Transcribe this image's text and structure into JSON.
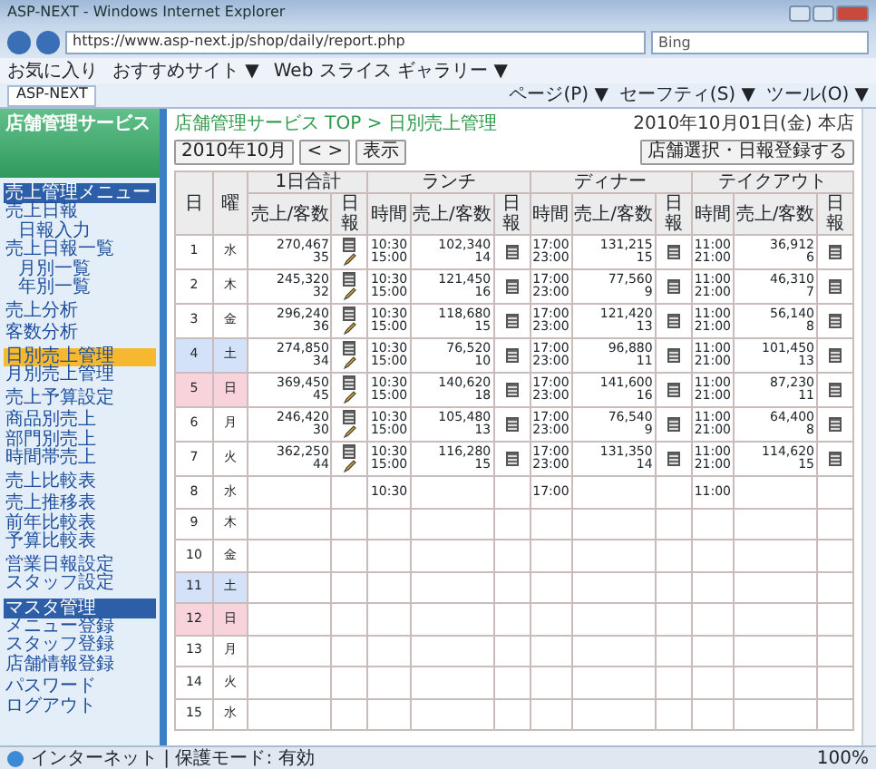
{
  "window": {
    "title": "ASP-NEXT - Windows Internet Explorer"
  },
  "browser": {
    "address": "https://www.asp-next.jp/shop/daily/report.php",
    "search_placeholder": "Bing",
    "favorites": [
      "お気に入り",
      "おすすめサイト ▼",
      "Web スライス ギャラリー ▼"
    ],
    "tab": "ASP-NEXT",
    "commands": [
      "ページ(P) ▼",
      "セーフティ(S) ▼",
      "ツール(O) ▼"
    ]
  },
  "sidebar": {
    "title": "店舗管理サービス",
    "sections": [
      {
        "title": "売上管理メニュー",
        "items": [
          {
            "label": "売上日報",
            "selected": false,
            "children": [
              {
                "label": "日報入力",
                "selected": false
              }
            ]
          },
          {
            "label": "売上日報一覧",
            "selected": false,
            "children": [
              {
                "label": "月別一覧",
                "selected": false
              },
              {
                "label": "年別一覧",
                "selected": false
              }
            ]
          }
        ]
      },
      {
        "items": [
          {
            "label": "売上分析",
            "selected": false
          }
        ]
      },
      {
        "items": [
          {
            "label": "客数分析",
            "selected": false
          }
        ]
      },
      {
        "items": [
          {
            "label": "日別売上管理",
            "selected": true
          },
          {
            "label": "月別売上管理",
            "selected": false
          }
        ]
      },
      {
        "items": [
          {
            "label": "売上予算設定",
            "selected": false
          }
        ]
      },
      {
        "items": [
          {
            "label": "商品別売上",
            "selected": false
          },
          {
            "label": "部門別売上",
            "selected": false
          },
          {
            "label": "時間帯売上",
            "selected": false
          }
        ]
      },
      {
        "items": [
          {
            "label": "売上比較表",
            "selected": false
          }
        ]
      },
      {
        "items": [
          {
            "label": "売上推移表",
            "selected": false
          },
          {
            "label": "前年比較表",
            "selected": false
          },
          {
            "label": "予算比較表",
            "selected": false
          }
        ]
      },
      {
        "items": [
          {
            "label": "営業日報設定",
            "selected": false
          },
          {
            "label": "スタッフ設定",
            "selected": false
          }
        ]
      },
      {
        "title": "マスタ管理",
        "items": [
          {
            "label": "メニュー登録",
            "selected": false
          },
          {
            "label": "スタッフ登録",
            "selected": false
          },
          {
            "label": "店舗情報登録",
            "selected": false
          }
        ]
      },
      {
        "items": [
          {
            "label": "パスワード",
            "selected": false
          },
          {
            "label": "ログアウト",
            "selected": false
          }
        ]
      }
    ]
  },
  "main": {
    "breadcrumb": "店舗管理サービス TOP > 日別売上管理",
    "date_info": "2010年10月01日(金) 本店",
    "month_select": "2010年10月",
    "nav_button": "< >",
    "show_button": "表示",
    "register_button": "店舗選択・日報登録する"
  },
  "table": {
    "day_header": "日",
    "weekday_header": "曜",
    "groups": [
      {
        "label": "1日合計",
        "columns": [
          "売上/客数",
          "日報"
        ]
      },
      {
        "label": "ランチ",
        "columns": [
          "時間",
          "売上/客数",
          "日報"
        ]
      },
      {
        "label": "ディナー",
        "columns": [
          "時間",
          "売上/客数",
          "日報"
        ]
      },
      {
        "label": "テイクアウト",
        "columns": [
          "時間",
          "売上/客数",
          "日報"
        ]
      }
    ],
    "rows": [
      {
        "day": "1",
        "weekday": "水",
        "cells": [
          {
            "sales": "270,467",
            "customers": "35",
            "report": true,
            "editable": true
          },
          {
            "times": [
              "10:30",
              "15:00"
            ],
            "sales": "102,340",
            "customers": "14",
            "report": true
          },
          {
            "times": [
              "17:00",
              "23:00"
            ],
            "sales": "131,215",
            "customers": "15",
            "report": true
          },
          {
            "times": [
              "11:00",
              "21:00"
            ],
            "sales": "36,912",
            "customers": "6",
            "report": true
          }
        ]
      },
      {
        "day": "2",
        "weekday": "木",
        "cells": [
          {
            "sales": "245,320",
            "customers": "32",
            "report": true,
            "editable": true
          },
          {
            "times": [
              "10:30",
              "15:00"
            ],
            "sales": "121,450",
            "customers": "16",
            "report": true
          },
          {
            "times": [
              "17:00",
              "23:00"
            ],
            "sales": "77,560",
            "customers": "9",
            "report": true
          },
          {
            "times": [
              "11:00",
              "21:00"
            ],
            "sales": "46,310",
            "customers": "7",
            "report": true
          }
        ]
      },
      {
        "day": "3",
        "weekday": "金",
        "cells": [
          {
            "sales": "296,240",
            "customers": "36",
            "report": true,
            "editable": true
          },
          {
            "times": [
              "10:30",
              "15:00"
            ],
            "sales": "118,680",
            "customers": "15",
            "report": true
          },
          {
            "times": [
              "17:00",
              "23:00"
            ],
            "sales": "121,420",
            "customers": "13",
            "report": true
          },
          {
            "times": [
              "11:00",
              "21:00"
            ],
            "sales": "56,140",
            "customers": "8",
            "report": true
          }
        ]
      },
      {
        "day": "4",
        "weekday": "土",
        "color": "#d3e2f8",
        "cells": [
          {
            "sales": "274,850",
            "customers": "34",
            "report": true,
            "editable": true
          },
          {
            "times": [
              "10:30",
              "15:00"
            ],
            "sales": "76,520",
            "customers": "10",
            "report": true
          },
          {
            "times": [
              "17:00",
              "23:00"
            ],
            "sales": "96,880",
            "customers": "11",
            "report": true
          },
          {
            "times": [
              "11:00",
              "21:00"
            ],
            "sales": "101,450",
            "customers": "13",
            "report": true
          }
        ]
      },
      {
        "day": "5",
        "weekday": "日",
        "color": "#f9d3dc",
        "cells": [
          {
            "sales": "369,450",
            "customers": "45",
            "report": true,
            "editable": true
          },
          {
            "times": [
              "10:30",
              "15:00"
            ],
            "sales": "140,620",
            "customers": "18",
            "report": true
          },
          {
            "times": [
              "17:00",
              "23:00"
            ],
            "sales": "141,600",
            "customers": "16",
            "report": true
          },
          {
            "times": [
              "11:00",
              "21:00"
            ],
            "sales": "87,230",
            "customers": "11",
            "report": true
          }
        ]
      },
      {
        "day": "6",
        "weekday": "月",
        "cells": [
          {
            "sales": "246,420",
            "customers": "30",
            "report": true,
            "editable": true
          },
          {
            "times": [
              "10:30",
              "15:00"
            ],
            "sales": "105,480",
            "customers": "13",
            "report": true
          },
          {
            "times": [
              "17:00",
              "23:00"
            ],
            "sales": "76,540",
            "customers": "9",
            "report": true
          },
          {
            "times": [
              "11:00",
              "21:00"
            ],
            "sales": "64,400",
            "customers": "8",
            "report": true
          }
        ]
      },
      {
        "day": "7",
        "weekday": "火",
        "cells": [
          {
            "sales": "362,250",
            "customers": "44",
            "report": true,
            "editable": true
          },
          {
            "times": [
              "10:30",
              "15:00"
            ],
            "sales": "116,280",
            "customers": "15",
            "report": true
          },
          {
            "times": [
              "17:00",
              "23:00"
            ],
            "sales": "131,350",
            "customers": "14",
            "report": true
          },
          {
            "times": [
              "11:00",
              "21:00"
            ],
            "sales": "114,620",
            "customers": "15",
            "report": true
          }
        ]
      },
      {
        "day": "8",
        "weekday": "水",
        "cells": [
          {},
          {
            "times": [
              "10:30"
            ]
          },
          {
            "times": [
              "17:00"
            ]
          },
          {
            "times": [
              "11:00"
            ]
          }
        ]
      },
      {
        "day": "9",
        "weekday": "木",
        "cells": []
      },
      {
        "day": "10",
        "weekday": "金",
        "cells": []
      },
      {
        "day": "11",
        "weekday": "土",
        "color": "#d3e2f8",
        "cells": []
      },
      {
        "day": "12",
        "weekday": "日",
        "color": "#f9d3dc",
        "cells": []
      },
      {
        "day": "13",
        "weekday": "月",
        "cells": []
      },
      {
        "day": "14",
        "weekday": "火",
        "cells": []
      },
      {
        "day": "15",
        "weekday": "水",
        "cells": []
      }
    ]
  },
  "status_bar": {
    "zone": "インターネット | 保護モード: 有効",
    "zoom": "100%"
  }
}
